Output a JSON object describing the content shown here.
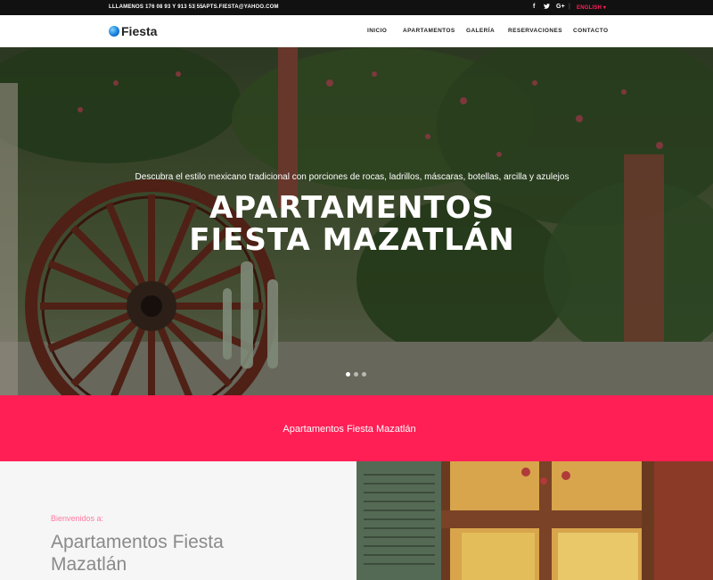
{
  "topbar": {
    "phone": "LLLAMENOS 176 08 93 Y 913 53 55",
    "email": "APTS.FIESTA@YAHOO.COM",
    "social": {
      "facebook": "f",
      "twitter": "t",
      "google": "G+"
    },
    "language": "ENGLISH ▾"
  },
  "brand": {
    "name": "Fiesta"
  },
  "nav": {
    "items": [
      {
        "label": "INICIO"
      },
      {
        "label": "APARTAMENTOS"
      },
      {
        "label": "GALERÍA"
      },
      {
        "label": "RESERVACIONES"
      },
      {
        "label": "CONTACTO"
      }
    ]
  },
  "hero": {
    "subtitle": "Descubra el estilo mexicano tradicional con porciones de rocas, ladrillos, máscaras, botellas, arcilla y azulejos",
    "title_line1": "APARTAMENTOS",
    "title_line2": "FIESTA MAZATLÁN",
    "slides": 3,
    "active_slide": 1
  },
  "band": {
    "text": "Apartamentos Fiesta Mazatlán"
  },
  "intro": {
    "welcome": "Bienvenidos a:",
    "heading_line1": "Apartamentos Fiesta",
    "heading_line2": "Mazatlán"
  },
  "colors": {
    "accent": "#ff1f55",
    "topbar_bg": "#111111"
  }
}
